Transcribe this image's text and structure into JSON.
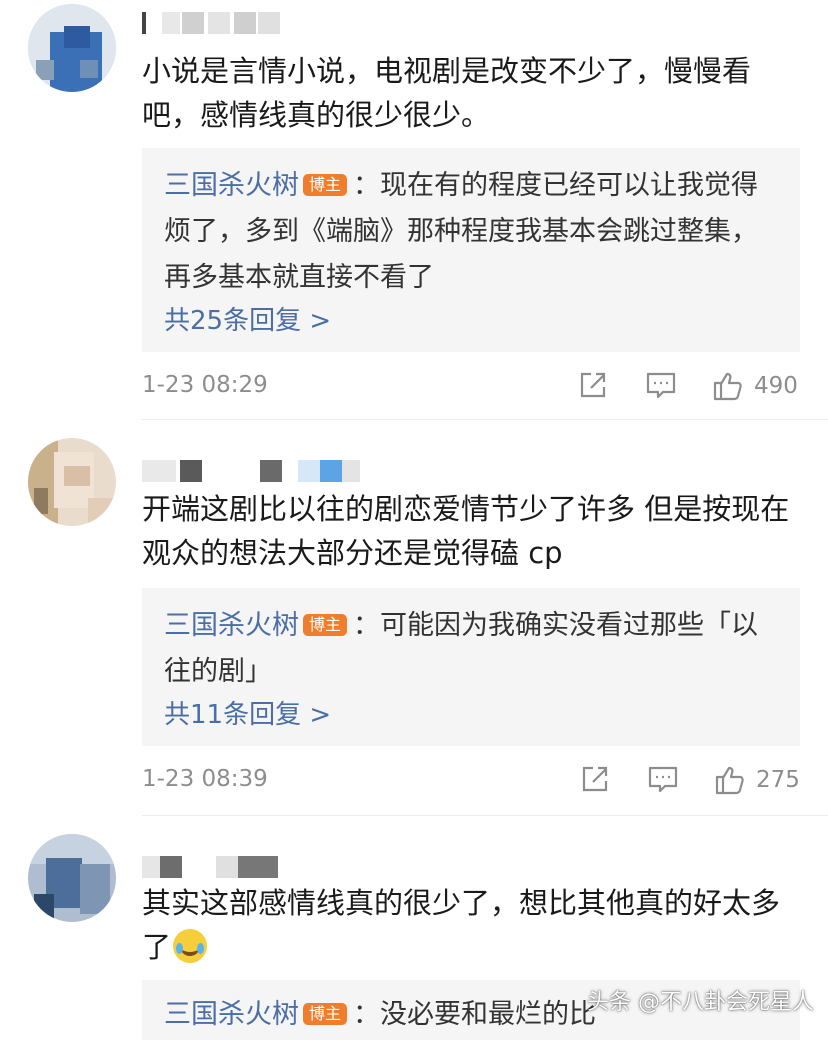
{
  "comments": [
    {
      "text": "小说是言情小说，电视剧是改变不少了，慢慢看吧，感情线真的很少很少。",
      "reply": {
        "author": "三国杀火树",
        "badge": "博主",
        "text": "：现在有的程度已经可以让我觉得烦了，多到《端脑》那种程度我基本会跳过整集，再多基本就直接不看了",
        "count_label": "共25条回复 >"
      },
      "timestamp": "1-23 08:29",
      "likes": "490"
    },
    {
      "text": "开端这剧比以往的剧恋爱情节少了许多 但是按现在观众的想法大部分还是觉得磕 cp",
      "reply": {
        "author": "三国杀火树",
        "badge": "博主",
        "text": "：可能因为我确实没看过那些「以往的剧」",
        "count_label": "共11条回复 >"
      },
      "timestamp": "1-23 08:39",
      "likes": "275"
    },
    {
      "text": "其实这部感情线真的很少了，想比其他真的好太多了",
      "reply": {
        "author": "三国杀火树",
        "badge": "博主",
        "text": "：没必要和最烂的比"
      }
    }
  ],
  "icons": {
    "share": "share-icon",
    "comment": "comment-icon",
    "like": "thumbs-up-icon",
    "emoji": "laughing-crying-emoji-icon"
  },
  "colors": {
    "author_link": "#4a6ea5",
    "badge": "#f07d2c",
    "meta": "#8d8d8d",
    "reply_bg": "#f5f5f5"
  },
  "watermark": "头条 @不八卦会死星人"
}
